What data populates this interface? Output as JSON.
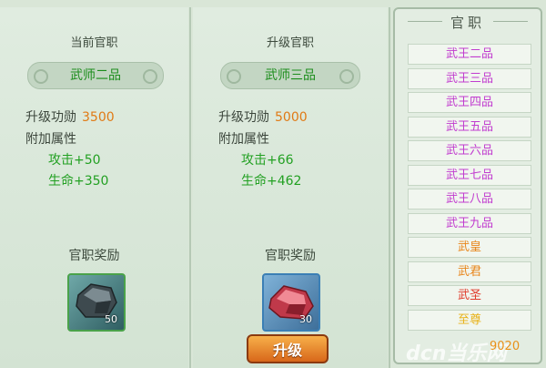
{
  "current": {
    "title": "当前官职",
    "rank": "武师二品",
    "merit_label": "升级功勋",
    "merit_value": "3500",
    "attr_label": "附加属性",
    "attack": "攻击+50",
    "life": "生命+350",
    "reward_title": "官职奖励",
    "reward_count": "50"
  },
  "next": {
    "title": "升级官职",
    "rank": "武师三品",
    "merit_label": "升级功勋",
    "merit_value": "5000",
    "attr_label": "附加属性",
    "attack": "攻击+66",
    "life": "生命+462",
    "reward_title": "官职奖励",
    "reward_count": "30"
  },
  "upgrade_button": "升级",
  "rank_list": {
    "title": "官职",
    "items": [
      {
        "label": "武王二品",
        "color": "#c13ccf"
      },
      {
        "label": "武王三品",
        "color": "#c13ccf"
      },
      {
        "label": "武王四品",
        "color": "#c13ccf"
      },
      {
        "label": "武王五品",
        "color": "#c13ccf"
      },
      {
        "label": "武王六品",
        "color": "#c13ccf"
      },
      {
        "label": "武王七品",
        "color": "#c13ccf"
      },
      {
        "label": "武王八品",
        "color": "#c13ccf"
      },
      {
        "label": "武王九品",
        "color": "#c13ccf"
      },
      {
        "label": "武皇",
        "color": "#e8851a"
      },
      {
        "label": "武君",
        "color": "#e8851a"
      },
      {
        "label": "武圣",
        "color": "#e03a2a"
      },
      {
        "label": "至尊",
        "color": "#e8b21a"
      }
    ]
  },
  "footer_number": "9020",
  "watermark": "dcn当乐网",
  "colors": {
    "bg": "#d9e6d7",
    "green_text": "#22a022",
    "orange_value": "#e07a15",
    "button": "#e5862a"
  },
  "icons": {
    "current_reward": "dark-ore-stone-icon",
    "next_reward": "red-crystal-ore-icon"
  }
}
